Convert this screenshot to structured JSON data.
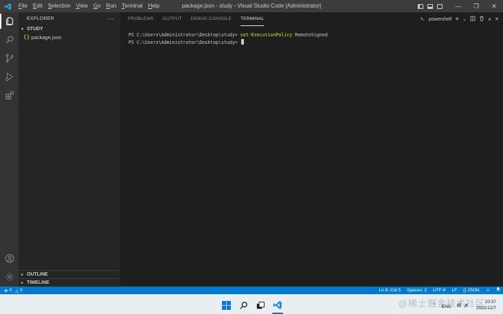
{
  "titlebar": {
    "menu": [
      "File",
      "Edit",
      "Selection",
      "View",
      "Go",
      "Run",
      "Terminal",
      "Help"
    ],
    "window_title": "package.json - study - Visual Studio Code [Administrator]",
    "controls": {
      "minimize": "—",
      "restore": "❐",
      "close": "✕"
    }
  },
  "activity_bar": {
    "icons": [
      "explorer-icon",
      "search-icon",
      "source-control-icon",
      "run-debug-icon",
      "extensions-icon",
      "account-icon",
      "manage-gear-icon"
    ]
  },
  "sidebar": {
    "header": "EXPLORER",
    "more": "···",
    "folder": "STUDY",
    "files": [
      {
        "icon": "{ }",
        "name": "package.json"
      }
    ],
    "outline": "OUTLINE",
    "timeline": "TIMELINE"
  },
  "panel": {
    "tabs": [
      "PROBLEMS",
      "OUTPUT",
      "DEBUG CONSOLE",
      "TERMINAL"
    ],
    "active_tab": "TERMINAL",
    "shell": "powershell",
    "actions": {
      "add": "+",
      "dropdown": "⌄",
      "split": "◫",
      "kill": "🗑",
      "maximize": "∧",
      "close": "✕"
    },
    "terminal": {
      "line1_prompt": "PS C:\\Users\\Administrator\\Desktop\\study> ",
      "line1_cmd": "set-ExecutionPolicy",
      "line1_arg": " RemoteSigned",
      "line2_prompt": "PS C:\\Users\\Administrator\\Desktop\\study> "
    }
  },
  "statusbar": {
    "errors": "0",
    "warnings": "0",
    "position": "Ln 8, Col 5",
    "spaces": "Spaces: 2",
    "encoding": "UTF-8",
    "eol": "LF",
    "language": "{} JSON"
  },
  "taskbar": {
    "lang": "ENG",
    "time": "20:37",
    "date": "2022/12/7",
    "watermark": "@稀土掘金技术社区"
  },
  "colors": {
    "statusbar": "#007acc",
    "titlebar": "#3c3c3c",
    "activity": "#333333",
    "sidebar": "#252526",
    "editor": "#1e1e1e",
    "command": "#e5e510"
  }
}
